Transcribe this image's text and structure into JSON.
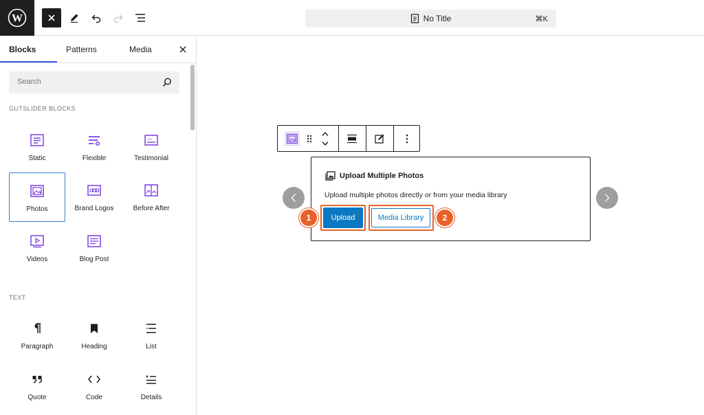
{
  "document": {
    "title": "No Title",
    "shortcut": "⌘K"
  },
  "sidebar": {
    "tabs": [
      {
        "label": "Blocks",
        "active": true
      },
      {
        "label": "Patterns",
        "active": false
      },
      {
        "label": "Media",
        "active": false
      }
    ],
    "search": {
      "placeholder": "Search",
      "value": ""
    },
    "sections": [
      {
        "label": "GUTSLIDER BLOCKS",
        "items": [
          {
            "label": "Static",
            "icon": "static-slider-icon"
          },
          {
            "label": "Flexible",
            "icon": "flexible-slider-icon"
          },
          {
            "label": "Testimonial",
            "icon": "testimonial-icon"
          },
          {
            "label": "Photos",
            "icon": "photos-icon",
            "selected": true
          },
          {
            "label": "Brand Logos",
            "icon": "brand-logos-icon"
          },
          {
            "label": "Before After",
            "icon": "before-after-icon"
          },
          {
            "label": "Videos",
            "icon": "videos-icon"
          },
          {
            "label": "Blog Post",
            "icon": "blog-post-icon"
          }
        ]
      },
      {
        "label": "TEXT",
        "items": [
          {
            "label": "Paragraph",
            "icon": "paragraph-icon"
          },
          {
            "label": "Heading",
            "icon": "heading-icon"
          },
          {
            "label": "List",
            "icon": "list-icon"
          },
          {
            "label": "Quote",
            "icon": "quote-icon"
          },
          {
            "label": "Code",
            "icon": "code-icon"
          },
          {
            "label": "Details",
            "icon": "details-icon"
          }
        ]
      }
    ]
  },
  "editor": {
    "placeholder": {
      "title": "Upload Multiple Photos",
      "description": "Upload multiple photos directly or from your media library",
      "upload_label": "Upload",
      "media_library_label": "Media Library"
    },
    "annotations": {
      "step1": "1",
      "step2": "2"
    }
  },
  "colors": {
    "accent": "#3858e9",
    "gutslider_icon": "#7b3fe4",
    "button_blue": "#0b78c2",
    "highlight": "#e8622a"
  }
}
